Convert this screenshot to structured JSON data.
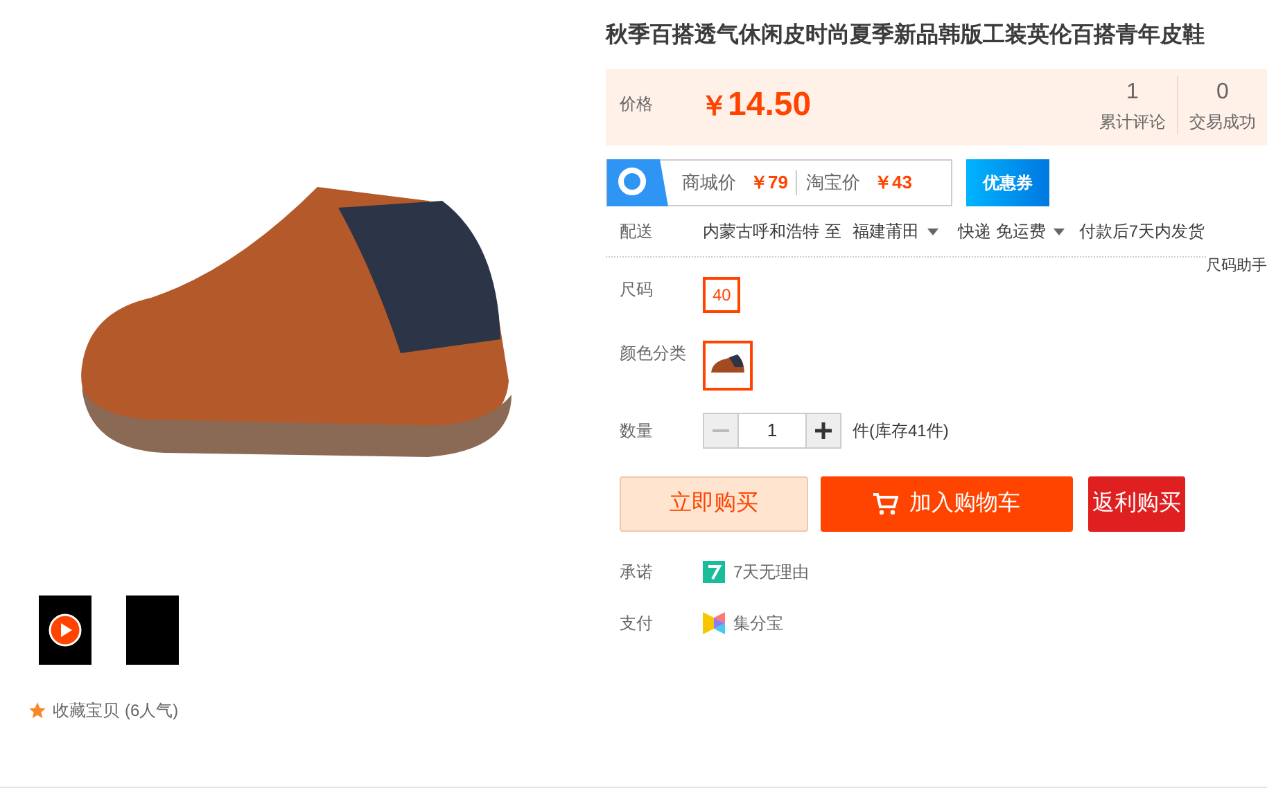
{
  "gallery": {
    "thumbnails": [
      {
        "kind": "video",
        "selected": false
      },
      {
        "kind": "image",
        "selected": false
      }
    ],
    "favorite": "收藏宝贝",
    "popularity": "(6人气)"
  },
  "product": {
    "title": "秋季百搭透气休闲皮时尚夏季新品韩版工装英伦百搭青年皮鞋",
    "price_label": "价格",
    "currency": "￥",
    "price": "14.50",
    "stats": [
      {
        "value": "1",
        "label": "累计评论"
      },
      {
        "value": "0",
        "label": "交易成功"
      }
    ],
    "compare": [
      {
        "label": "商城价",
        "price": "￥79"
      },
      {
        "label": "淘宝价",
        "price": "￥43"
      }
    ],
    "coupon": "优惠券",
    "delivery": {
      "label": "配送",
      "from": "内蒙古呼和浩特",
      "to_word": "至",
      "to": "福建莆田",
      "method": "快递 免运费",
      "ship": "付款后7天内发货"
    },
    "size_helper": "尺码助手",
    "size": {
      "label": "尺码",
      "options": [
        {
          "text": "40",
          "selected": true
        }
      ]
    },
    "color": {
      "label": "颜色分类",
      "options": [
        {
          "selected": true
        }
      ]
    },
    "quantity": {
      "label": "数量",
      "value": "1",
      "stock": "件(库存41件)"
    },
    "buttons": [
      {
        "kind": "buy",
        "text": "立即购买"
      },
      {
        "kind": "cart",
        "text": "加入购物车"
      },
      {
        "kind": "rebate",
        "text": "返利购买"
      }
    ],
    "services": [
      {
        "kind": "promise",
        "label": "承诺",
        "text": "7天无理由"
      },
      {
        "kind": "payment",
        "label": "支付",
        "text": "集分宝"
      }
    ]
  }
}
